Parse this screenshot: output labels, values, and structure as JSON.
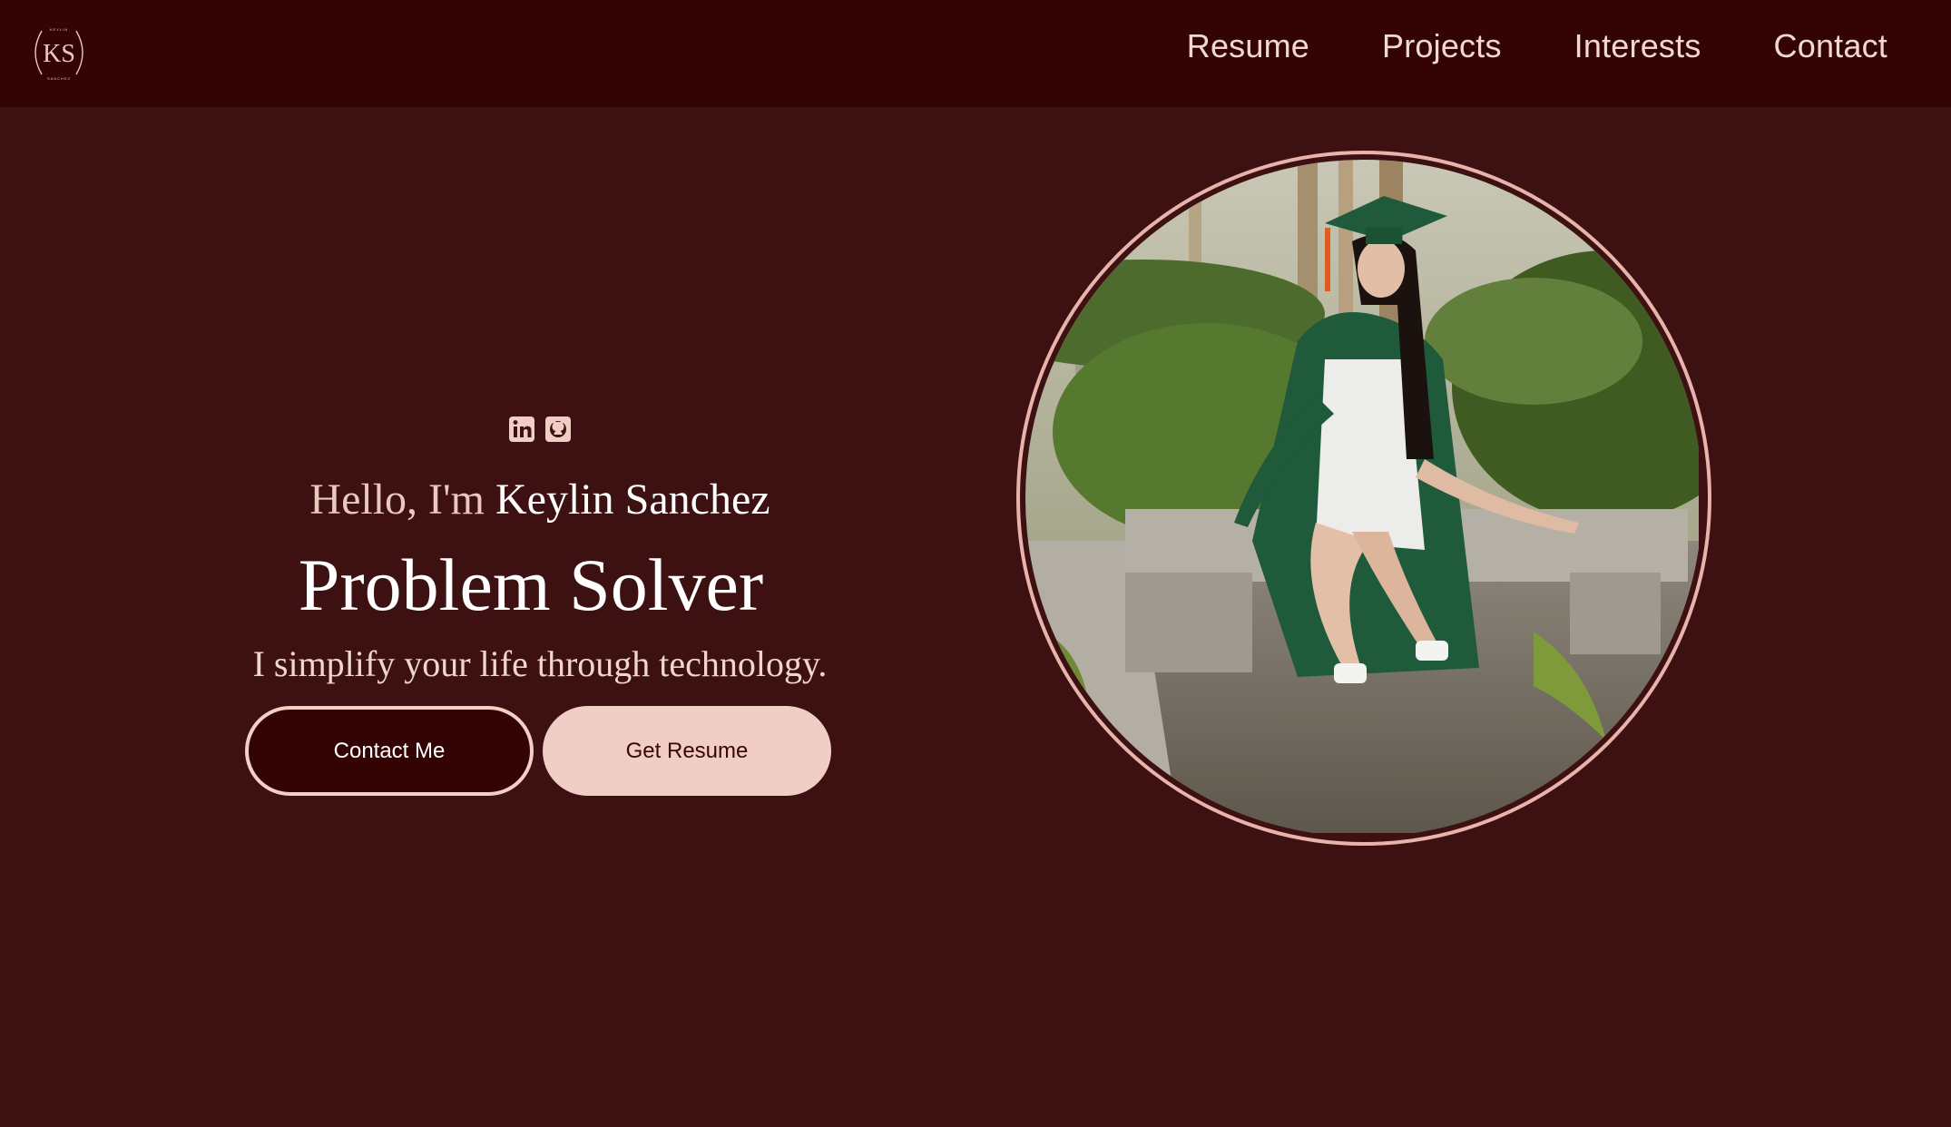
{
  "nav": {
    "logo_text": "KS",
    "logo_caption_top": "KEYLIN",
    "logo_caption_bottom": "SANCHEZ",
    "links": [
      "Resume",
      "Projects",
      "Interests",
      "Contact"
    ]
  },
  "hero": {
    "greeting_prefix": "Hello, I'm",
    "name": "Keylin Sanchez",
    "headline": "Problem Solver",
    "tagline": "I simplify your life through technology.",
    "contact_button": "Contact Me",
    "resume_button": "Get Resume",
    "socials": [
      "linkedin-icon",
      "github-icon"
    ]
  },
  "colors": {
    "background": "#3d1111",
    "navbar": "#340404",
    "accent": "#f0cec5",
    "text": "#f1d9cf"
  }
}
